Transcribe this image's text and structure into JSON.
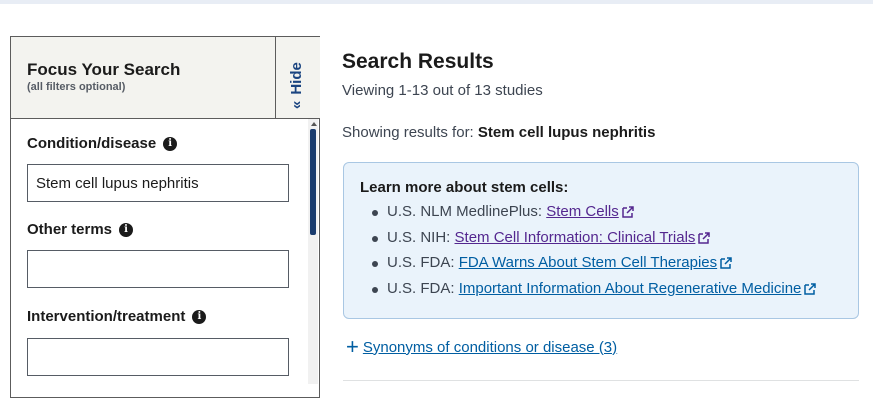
{
  "filters": {
    "title": "Focus Your Search",
    "subtitle": "(all filters optional)",
    "hide_label": "Hide",
    "hide_chevron": "«",
    "fields": [
      {
        "label": "Condition/disease",
        "value": "Stem cell lupus nephritis",
        "placeholder": ""
      },
      {
        "label": "Other terms",
        "value": "",
        "placeholder": ""
      },
      {
        "label": "Intervention/treatment",
        "value": "",
        "placeholder": ""
      }
    ],
    "info_glyph": "i"
  },
  "results": {
    "title": "Search Results",
    "count": "Viewing 1-13 out of 13 studies",
    "showing_prefix": "Showing results for:",
    "showing_query": "Stem cell lupus nephritis"
  },
  "learn_more": {
    "title": "Learn more about stem cells:",
    "items": [
      {
        "prefix": "U.S. NLM MedlinePlus:",
        "link": "Stem Cells",
        "color": "#54278f"
      },
      {
        "prefix": "U.S. NIH:",
        "link": "Stem Cell Information: Clinical Trials",
        "color": "#54278f"
      },
      {
        "prefix": "U.S. FDA:",
        "link": "FDA Warns About Stem Cell Therapies",
        "color": "#005ea2"
      },
      {
        "prefix": "U.S. FDA:",
        "link": "Important Information About Regenerative Medicine",
        "color": "#005ea2"
      }
    ]
  },
  "synonyms": {
    "plus": "+",
    "label": "Synonyms of conditions or disease (3)"
  },
  "colors": {
    "link_blue": "#005ea2",
    "link_visited": "#54278f",
    "panel_header_bg": "#f3f3ef",
    "info_box_bg": "#eaf3fb"
  }
}
